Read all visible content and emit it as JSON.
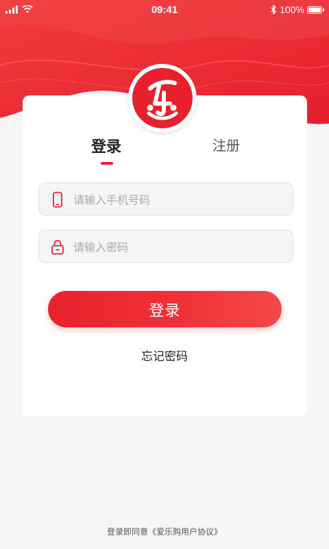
{
  "status_bar": {
    "time": "09:41",
    "battery": "100%",
    "battery_level": 1.0
  },
  "logo": {
    "glyph": "乐"
  },
  "tabs": [
    {
      "label": "登录",
      "active": true
    },
    {
      "label": "注册",
      "active": false
    }
  ],
  "form": {
    "phone_placeholder": "请输入手机号码",
    "phone_value": "",
    "password_placeholder": "请输入密码",
    "password_value": "",
    "login_button_label": "登录",
    "forgot_label": "忘记密码"
  },
  "footer": {
    "agreement": "登录即同意《爱乐购用户协议》"
  },
  "colors": {
    "brand": "#e8202d",
    "background": "#f6f6f6"
  },
  "icons": {
    "phone": "phone-icon",
    "lock": "lock-icon",
    "wifi": "wifi-icon",
    "bluetooth": "bluetooth-icon",
    "signal": "signal-icon",
    "battery": "battery-icon"
  }
}
